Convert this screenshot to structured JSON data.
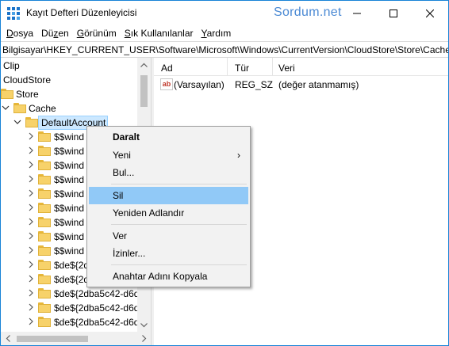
{
  "window": {
    "title": "Kayıt Defteri Düzenleyicisi",
    "watermark": "Sordum.net"
  },
  "menu": [
    {
      "label_acc": "D",
      "label_rest": "osya"
    },
    {
      "label_acc": "",
      "label_pre": "Dü",
      "label_u": "z",
      "label_post": "en"
    },
    {
      "label_acc": "G",
      "label_rest": "örünüm"
    },
    {
      "label_acc": "S",
      "label_rest": "ık Kullanılanlar"
    },
    {
      "label_acc": "Y",
      "label_rest": "ardım"
    }
  ],
  "address": "Bilgisayar\\HKEY_CURRENT_USER\\Software\\Microsoft\\Windows\\CurrentVersion\\CloudStore\\Store\\Cache\\",
  "tree": {
    "items": [
      {
        "label": "Clip"
      },
      {
        "label": "CloudStore"
      },
      {
        "label": "Store"
      },
      {
        "label": "Cache"
      },
      {
        "label": "DefaultAccount"
      },
      {
        "label": "$$wind"
      },
      {
        "label": "$$wind"
      },
      {
        "label": "$$wind"
      },
      {
        "label": "$$wind"
      },
      {
        "label": "$$wind"
      },
      {
        "label": "$$wind"
      },
      {
        "label": "$$wind"
      },
      {
        "label": "$$wind"
      },
      {
        "label": "$$wind"
      },
      {
        "label": "$de${2d"
      },
      {
        "label": "$de${2d"
      },
      {
        "label": "$de${2dba5c42-d6d"
      },
      {
        "label": "$de${2dba5c42-d6d"
      },
      {
        "label": "$de${2dba5c42-d6d"
      },
      {
        "label": "$de${2dba5c42-d6d"
      }
    ]
  },
  "list": {
    "columns": [
      "Ad",
      "Tür",
      "Veri"
    ],
    "rows": [
      {
        "name": "(Varsayılan)",
        "type": "REG_SZ",
        "data": "(değer atanmamış)",
        "icon": "string-value-icon"
      }
    ]
  },
  "context_menu": {
    "items": [
      {
        "label": "Daralt",
        "bold": true
      },
      {
        "label": "Yeni",
        "submenu": true
      },
      {
        "label": "Bul..."
      },
      {
        "label": "Sil",
        "highlighted": true
      },
      {
        "label": "Yeniden Adlandır"
      },
      {
        "label": "Ver"
      },
      {
        "label": "İzinler..."
      },
      {
        "label": "Anahtar Adını Kopyala"
      }
    ],
    "submenu_glyph": "›"
  },
  "colors": {
    "highlight": "#91c9f7",
    "tree_selection": "#cce8ff",
    "folder": "#f7d26a",
    "window_border": "#1883d7"
  }
}
